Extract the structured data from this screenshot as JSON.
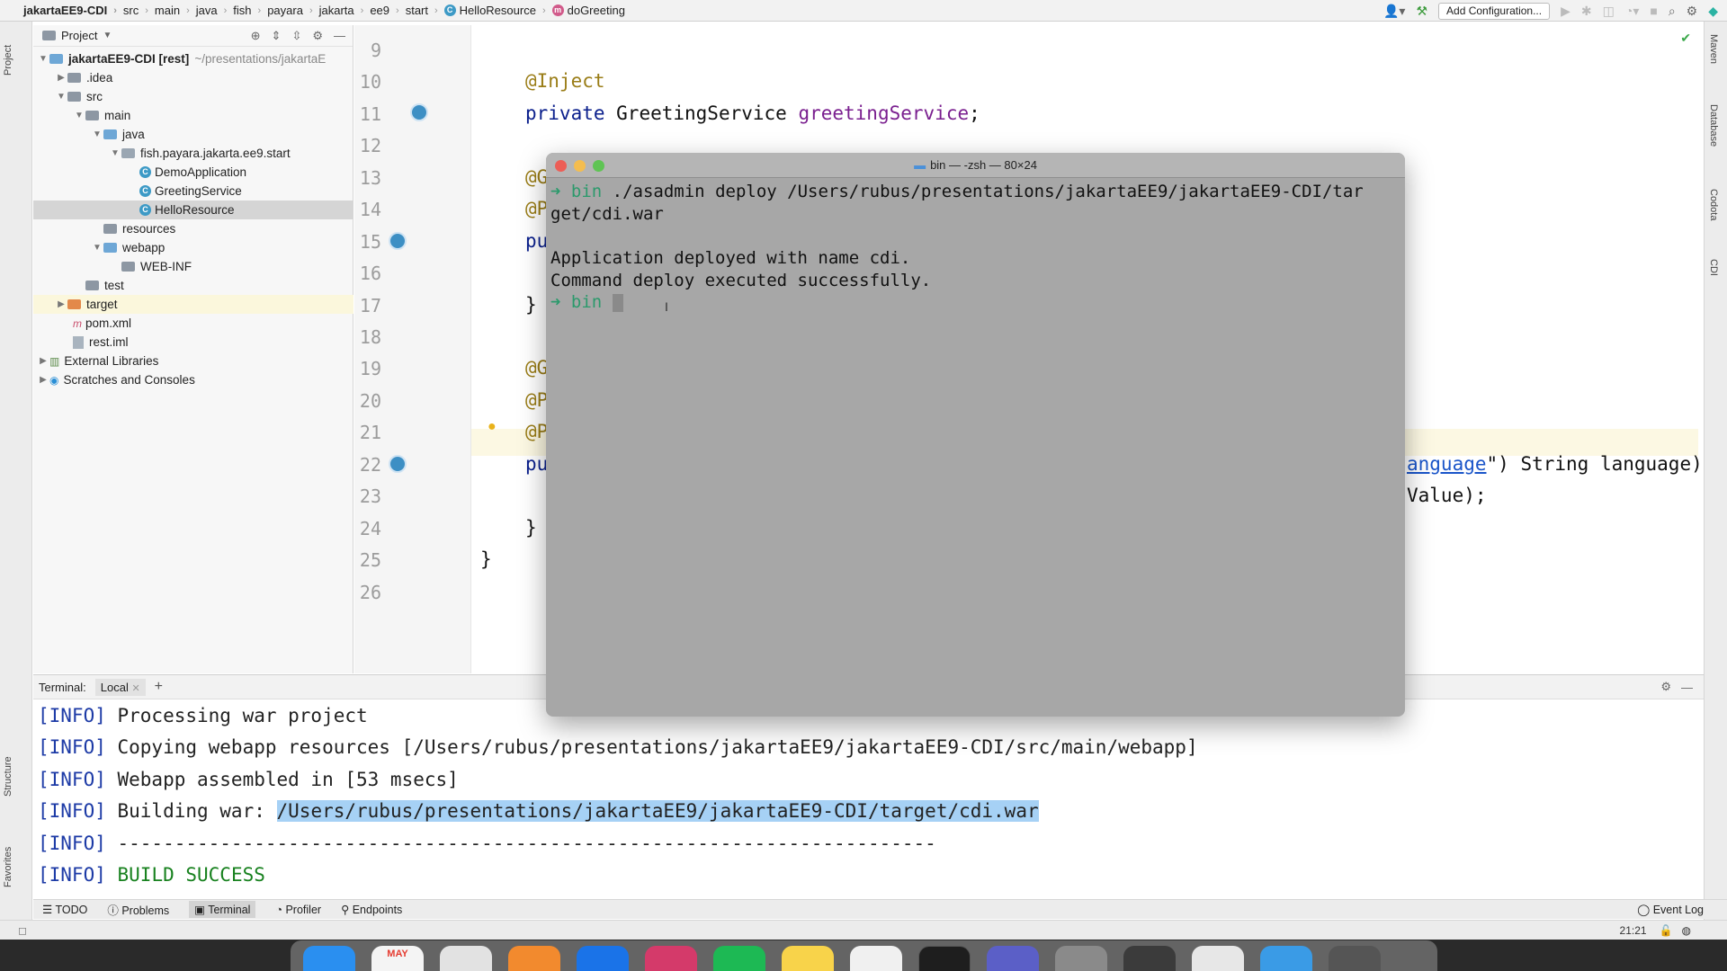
{
  "navbar": {
    "crumbs": [
      "jakartaEE9-CDI",
      "src",
      "main",
      "java",
      "fish",
      "payara",
      "jakarta",
      "ee9",
      "start",
      "HelloResource",
      "doGreeting"
    ],
    "add_configuration": "Add Configuration..."
  },
  "left_strip": {
    "project": "Project",
    "structure": "Structure",
    "favorites": "Favorites"
  },
  "right_strip": {
    "maven": "Maven",
    "database": "Database",
    "codota": "Codota",
    "cdi": "CDI"
  },
  "project_panel": {
    "title": "Project",
    "tree": [
      {
        "label": "jakartaEE9-CDI [rest]",
        "path": "~/presentations/jakartaE",
        "indent": 0,
        "arrow": "down",
        "icon": "module"
      },
      {
        "label": ".idea",
        "indent": 1,
        "arrow": "right",
        "icon": "folder"
      },
      {
        "label": "src",
        "indent": 1,
        "arrow": "down",
        "icon": "folder"
      },
      {
        "label": "main",
        "indent": 2,
        "arrow": "down",
        "icon": "folder"
      },
      {
        "label": "java",
        "indent": 3,
        "arrow": "down",
        "icon": "folder-blue"
      },
      {
        "label": "fish.payara.jakarta.ee9.start",
        "indent": 4,
        "arrow": "down",
        "icon": "package"
      },
      {
        "label": "DemoApplication",
        "indent": 5,
        "arrow": "",
        "icon": "class"
      },
      {
        "label": "GreetingService",
        "indent": 5,
        "arrow": "",
        "icon": "class"
      },
      {
        "label": "HelloResource",
        "indent": 5,
        "arrow": "",
        "icon": "class",
        "selected": true
      },
      {
        "label": "resources",
        "indent": 3,
        "arrow": "",
        "icon": "folder"
      },
      {
        "label": "webapp",
        "indent": 3,
        "arrow": "down",
        "icon": "folder-blue"
      },
      {
        "label": "WEB-INF",
        "indent": 4,
        "arrow": "",
        "icon": "folder"
      },
      {
        "label": "test",
        "indent": 2,
        "arrow": "",
        "icon": "folder"
      },
      {
        "label": "target",
        "indent": 1,
        "arrow": "right",
        "icon": "folder-orange",
        "highlight": true
      },
      {
        "label": "pom.xml",
        "indent": 1,
        "arrow": "",
        "icon": "maven"
      },
      {
        "label": "rest.iml",
        "indent": 1,
        "arrow": "",
        "icon": "file"
      },
      {
        "label": "External Libraries",
        "indent": 0,
        "arrow": "right",
        "icon": "library"
      },
      {
        "label": "Scratches and Consoles",
        "indent": 0,
        "arrow": "right",
        "icon": "scratch"
      }
    ]
  },
  "editor": {
    "line_numbers": [
      "9",
      "10",
      "11",
      "12",
      "13",
      "14",
      "15",
      "16",
      "17",
      "18",
      "19",
      "20",
      "21",
      "22",
      "23",
      "24",
      "25",
      "26"
    ],
    "line10": "@Inject",
    "line11_kw": "private",
    "line11_type": " GreetingService ",
    "line11_field": "greetingService",
    "line11_end": ";",
    "frag13": "@G",
    "frag14": "@P",
    "frag15": "pu",
    "frag17": "}",
    "frag19": "@G",
    "frag20": "@P",
    "frag21": "@P",
    "frag22": "pu",
    "frag24": "}",
    "frag25": "}",
    "line22_tail_link": "anguage",
    "line22_tail_rest": "\") String language)",
    "line23_tail": "Value);"
  },
  "terminal_window": {
    "title": "bin — -zsh — 80×24",
    "prompt_arrow": "➜",
    "prompt_dir": "bin",
    "command_line1": " ./asadmin deploy /Users/rubus/presentations/jakartaEE9/jakartaEE9-CDI/tar",
    "command_line2": "get/cdi.war",
    "output1": "Application deployed with name cdi.",
    "output2": "Command deploy executed successfully."
  },
  "terminal_panel": {
    "label": "Terminal:",
    "tab": "Local",
    "add": "+",
    "lines": [
      {
        "tag": "[INFO]",
        "text": " Processing war project"
      },
      {
        "tag": "[INFO]",
        "text": " Copying webapp resources [/Users/rubus/presentations/jakartaEE9/jakartaEE9-CDI/src/main/webapp]"
      },
      {
        "tag": "[INFO]",
        "text": " Webapp assembled in [53 msecs]"
      },
      {
        "tag": "[INFO]",
        "text": " Building war: ",
        "selected": "/Users/rubus/presentations/jakartaEE9/jakartaEE9-CDI/target/cdi.war"
      },
      {
        "tag": "[INFO]",
        "text": " ------------------------------------------------------------------------"
      },
      {
        "tag": "[INFO]",
        "text": " ",
        "success": "BUILD SUCCESS"
      }
    ]
  },
  "bottom_tabs": [
    "TODO",
    "Problems",
    "Terminal",
    "Profiler",
    "Endpoints"
  ],
  "event_log": "Event Log",
  "status": {
    "time": "21:21"
  },
  "dock": {
    "calendar_month": "MAY"
  }
}
